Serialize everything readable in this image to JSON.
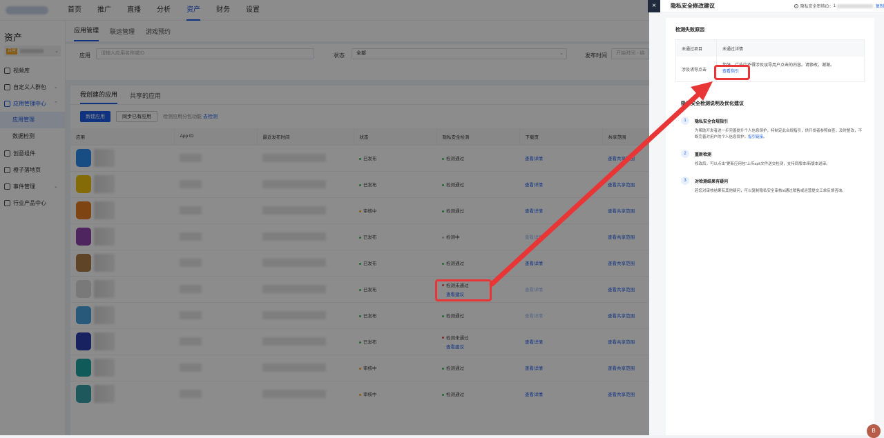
{
  "topnav": {
    "items": [
      "首页",
      "推广",
      "直播",
      "分析",
      "资产",
      "财务",
      "设置"
    ],
    "active": "资产"
  },
  "sidebar": {
    "title": "资产",
    "account_tag": "自营",
    "items": [
      {
        "label": "视频库"
      },
      {
        "label": "自定义人群包"
      },
      {
        "label": "应用管理中心"
      },
      {
        "label": "创意组件"
      },
      {
        "label": "橙子落地页"
      },
      {
        "label": "事件管理"
      },
      {
        "label": "行业产品中心"
      }
    ],
    "sub_items": [
      "应用管理",
      "数据检测"
    ]
  },
  "main_tabs": [
    "应用管理",
    "联运管理",
    "游戏预约"
  ],
  "filters": {
    "app_label": "应用",
    "app_placeholder": "请输入应用名称或ID",
    "status_label": "状态",
    "status_value": "全部",
    "date_label": "发布时间",
    "date_placeholder": "开始时间 - 结"
  },
  "sub_tabs": [
    "我创建的应用",
    "共享的应用"
  ],
  "actions": {
    "new_app": "新建应用",
    "sync_app": "同步已有应用",
    "hint": "检测应用分包功能",
    "hint_link": "去检测"
  },
  "table": {
    "headers": [
      "应用",
      "App ID",
      "最近发布时间",
      "状态",
      "隐私安全检测",
      "下载页",
      "共享范围"
    ],
    "rows": [
      {
        "icon_color": "#2d8cf0",
        "status": "已发布",
        "status_dot": "green",
        "privacy": "检测通过",
        "privacy_dot": "green",
        "privacy_link": "",
        "download": "查看详情",
        "download_dim": false,
        "share": "查看共享范围"
      },
      {
        "icon_color": "#f1c40f",
        "status": "已发布",
        "status_dot": "green",
        "privacy": "检测通过",
        "privacy_dot": "green",
        "privacy_link": "",
        "download": "查看详情",
        "download_dim": false,
        "share": "查看共享范围"
      },
      {
        "icon_color": "#e67e22",
        "status": "审核中",
        "status_dot": "orange",
        "privacy": "检测通过",
        "privacy_dot": "green",
        "privacy_link": "",
        "download": "查看详情",
        "download_dim": false,
        "share": "查看共享范围"
      },
      {
        "icon_color": "#8e44ad",
        "status": "已发布",
        "status_dot": "green",
        "privacy": "检测中",
        "privacy_dot": "gray",
        "privacy_link": "",
        "download": "查看详情",
        "download_dim": true,
        "share": "查看共享范围"
      },
      {
        "icon_color": "#b07d4a",
        "status": "已发布",
        "status_dot": "green",
        "privacy": "检测通过",
        "privacy_dot": "green",
        "privacy_link": "",
        "download": "查看详情",
        "download_dim": false,
        "share": "查看共享范围"
      },
      {
        "icon_color": "#dcdcdc",
        "status": "已发布",
        "status_dot": "green",
        "privacy": "检测未通过",
        "privacy_dot": "red",
        "privacy_link": "查看建议",
        "download": "查看详情",
        "download_dim": true,
        "share": "查看共享范围"
      },
      {
        "icon_color": "#4aa3df",
        "status": "已发布",
        "status_dot": "green",
        "privacy": "检测通过",
        "privacy_dot": "green",
        "privacy_link": "",
        "download": "查看详情",
        "download_dim": true,
        "share": "查看共享范围"
      },
      {
        "icon_color": "#2f3fb0",
        "status": "已发布",
        "status_dot": "green",
        "privacy": "检测未通过",
        "privacy_dot": "red",
        "privacy_link": "查看建议",
        "download": "查看详情",
        "download_dim": false,
        "share": "查看共享范围"
      },
      {
        "icon_color": "#1fa5a5",
        "status": "审核中",
        "status_dot": "orange",
        "privacy": "检测通过",
        "privacy_dot": "green",
        "privacy_link": "",
        "download": "查看详情",
        "download_dim": false,
        "share": "查看共享范围"
      },
      {
        "icon_color": "#3aa0a8",
        "status": "审核中",
        "status_dot": "orange",
        "privacy": "检测通过",
        "privacy_dot": "green",
        "privacy_link": "",
        "download": "查看详情",
        "download_dim": false,
        "share": "查看共享范围"
      }
    ]
  },
  "drawer": {
    "close": "×",
    "title": "隐私安全修改建议",
    "audit_label": "隐私安全审核ID：",
    "audit_id_prefix": "1",
    "copy": "复制",
    "fail_section_title": "检测失败原因",
    "fail_headers": [
      "未通过项目",
      "未通过详情"
    ],
    "fail_item": "涉及诱导点击",
    "fail_detail": "您好，广告中不得涉及误导用户点击的内容。请修改，谢谢。",
    "fail_link": "查看指引",
    "advice_title": "隐私安全检测说明及优化建议",
    "steps": [
      {
        "num": "1",
        "title": "隐私安全合规指引",
        "desc": "为帮助开发者进一步完善提升个人信息保护，特制定此合规指引，供开发者参照自查，及时整改，不断完善对用户的个人信息保护。",
        "link": "指引链接",
        "suffix": "。"
      },
      {
        "num": "2",
        "title": "重新检测",
        "desc": "修改后，可以点击\"更新应用包\"上传apk文件送交检测，支持同版本/新版本送审。",
        "link": "",
        "suffix": ""
      },
      {
        "num": "3",
        "title": "对检测结果有疑问",
        "desc": "若您对审核结果有其他疑问，可以复制隐私安全审核id通过销售或运营提交工单反馈咨询。",
        "link": "",
        "suffix": ""
      }
    ]
  },
  "avatar": "B",
  "colors": {
    "primary": "#1d5de8",
    "annotation": "#e83535"
  }
}
